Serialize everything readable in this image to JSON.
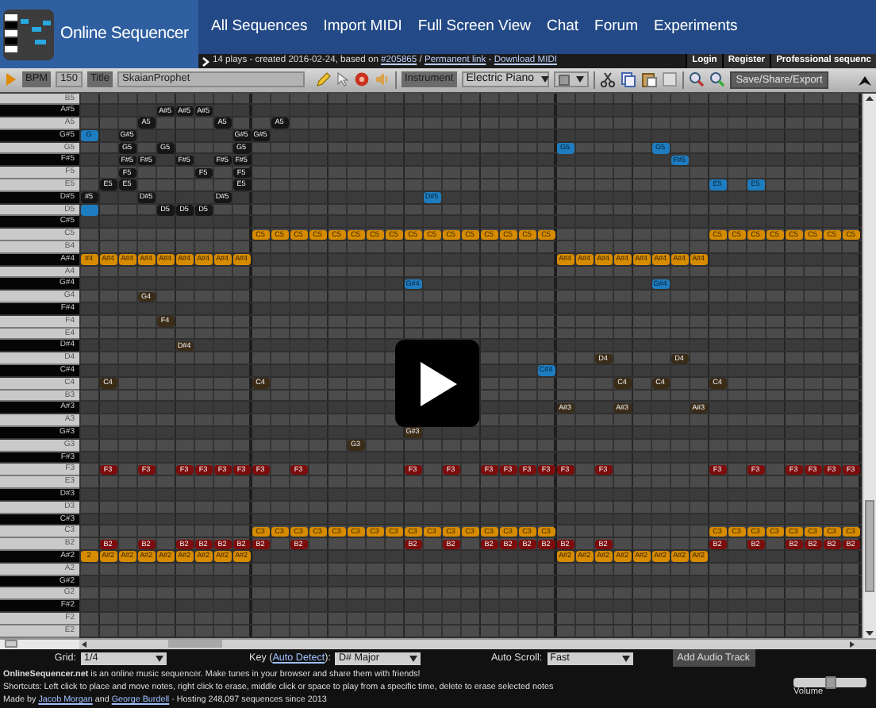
{
  "header": {
    "site_name": "Online Sequencer",
    "nav": [
      "All Sequences",
      "Import MIDI",
      "Full Screen View",
      "Chat",
      "Forum",
      "Experiments"
    ]
  },
  "info_bar": {
    "segments": [
      {
        "kind": "text",
        "text": "14 plays - created 2016-02-24, based on"
      },
      {
        "kind": "link",
        "text": "#205865"
      },
      {
        "kind": "text",
        "text": "/"
      },
      {
        "kind": "link",
        "text": "Permanent link"
      },
      {
        "kind": "text",
        "text": "-"
      },
      {
        "kind": "link",
        "text": "Download MIDI"
      }
    ],
    "account_links": [
      "Login",
      "Register",
      "Professional sequenc"
    ]
  },
  "toolbar": {
    "bpm_label": "BPM",
    "bpm": "150",
    "title_label": "Title",
    "title": "SkaianProphet",
    "instrument_label": "Instrument",
    "instrument": "Electric Piano",
    "save_button": "Save/Share/Export"
  },
  "piano_roll": {
    "rows": [
      {
        "key": "B5",
        "black": false
      },
      {
        "key": "A#5",
        "black": true,
        "cells": [
          null,
          null,
          null,
          null,
          {
            "text": "A#5",
            "color": "#161616"
          },
          {
            "text": "A#5",
            "color": "#161616"
          },
          {
            "text": "A#5",
            "color": "#161616"
          }
        ]
      },
      {
        "key": "A5",
        "black": false,
        "cells": [
          null,
          null,
          null,
          {
            "text": "A5",
            "color": "#161616"
          },
          null,
          null,
          null,
          {
            "text": "A5",
            "color": "#161616"
          },
          null,
          null,
          {
            "text": "A5",
            "color": "#161616"
          }
        ]
      },
      {
        "key": "G#5",
        "black": true,
        "cells": [
          {
            "text": "G",
            "color": "#1e7dc0"
          },
          null,
          {
            "text": "G#5",
            "color": "#161616"
          },
          null,
          null,
          null,
          null,
          null,
          {
            "text": "G#5",
            "color": "#161616"
          },
          {
            "text": "G#5",
            "color": "#161616"
          }
        ]
      },
      {
        "key": "G5",
        "black": false,
        "cells": [
          null,
          null,
          {
            "text": "G5",
            "color": "#161616"
          },
          null,
          {
            "text": "G5",
            "color": "#161616"
          },
          null,
          null,
          null,
          {
            "text": "G5",
            "color": "#161616"
          },
          null,
          null,
          null,
          null,
          null,
          null,
          null,
          null,
          null,
          null,
          null,
          null,
          null,
          null,
          null,
          null,
          {
            "text": "G5",
            "color": "#1e7dc0"
          },
          null,
          null,
          null,
          null,
          {
            "text": "G5",
            "color": "#1e7dc0"
          }
        ]
      },
      {
        "key": "F#5",
        "black": true,
        "cells": [
          null,
          null,
          {
            "text": "F#5",
            "color": "#161616"
          },
          {
            "text": "F#5",
            "color": "#161616"
          },
          null,
          {
            "text": "F#5",
            "color": "#161616"
          },
          null,
          {
            "text": "F#5",
            "color": "#161616"
          },
          {
            "text": "F#5",
            "color": "#161616"
          },
          null,
          null,
          null,
          null,
          null,
          null,
          null,
          null,
          null,
          null,
          null,
          null,
          null,
          null,
          null,
          null,
          null,
          null,
          null,
          null,
          null,
          null,
          {
            "text": "F#5",
            "color": "#1e7dc0"
          }
        ]
      },
      {
        "key": "F5",
        "black": false,
        "cells": [
          null,
          null,
          {
            "text": "F5",
            "color": "#161616"
          },
          null,
          null,
          null,
          {
            "text": "F5",
            "color": "#161616"
          },
          null,
          {
            "text": "F5",
            "color": "#161616"
          }
        ]
      },
      {
        "key": "E5",
        "black": false,
        "cells": [
          null,
          {
            "text": "E5",
            "color": "#161616"
          },
          {
            "text": "E5",
            "color": "#161616"
          },
          null,
          null,
          null,
          null,
          null,
          {
            "text": "E5",
            "color": "#161616"
          },
          null,
          null,
          null,
          null,
          null,
          null,
          null,
          null,
          null,
          null,
          null,
          null,
          null,
          null,
          null,
          null,
          null,
          null,
          null,
          null,
          null,
          null,
          null,
          null,
          {
            "text": "E5",
            "color": "#1e7dc0"
          },
          null,
          {
            "text": "E5",
            "color": "#1e7dc0"
          }
        ]
      },
      {
        "key": "D#5",
        "black": true,
        "cells": [
          {
            "text": "#5",
            "color": "#161616"
          },
          null,
          null,
          {
            "text": "D#5",
            "color": "#161616"
          },
          null,
          null,
          null,
          {
            "text": "D#5",
            "color": "#161616"
          },
          null,
          null,
          null,
          null,
          null,
          null,
          null,
          null,
          null,
          null,
          {
            "text": "D#5",
            "color": "#1e7dc0"
          }
        ]
      },
      {
        "key": "D5",
        "black": false,
        "cells": [
          {
            "color": "#1e7dc0"
          },
          null,
          null,
          null,
          {
            "text": "D5",
            "color": "#161616"
          },
          {
            "text": "D5",
            "color": "#161616"
          },
          {
            "text": "D5",
            "color": "#161616"
          }
        ]
      },
      {
        "key": "C#5",
        "black": true
      },
      {
        "key": "C5",
        "black": false,
        "cells": [
          null,
          null,
          null,
          null,
          null,
          null,
          null,
          null,
          null,
          {
            "text": "C5",
            "color": "#d68b00"
          },
          {
            "text": "C5",
            "color": "#d68b00"
          },
          {
            "text": "C5",
            "color": "#d68b00"
          },
          {
            "text": "C5",
            "color": "#d68b00"
          },
          {
            "text": "C5",
            "color": "#d68b00"
          },
          {
            "text": "C5",
            "color": "#d68b00"
          },
          {
            "text": "C5",
            "color": "#d68b00"
          },
          {
            "text": "C5",
            "color": "#d68b00"
          },
          {
            "text": "C5",
            "color": "#d68b00"
          },
          {
            "text": "C5",
            "color": "#d68b00"
          },
          {
            "text": "C5",
            "color": "#d68b00"
          },
          {
            "text": "C5",
            "color": "#d68b00"
          },
          {
            "text": "C5",
            "color": "#d68b00"
          },
          {
            "text": "C5",
            "color": "#d68b00"
          },
          {
            "text": "C5",
            "color": "#d68b00"
          },
          {
            "text": "C5",
            "color": "#d68b00"
          },
          null,
          null,
          null,
          null,
          null,
          null,
          null,
          null,
          {
            "text": "C5",
            "color": "#d68b00"
          },
          {
            "text": "C5",
            "color": "#d68b00"
          },
          {
            "text": "C5",
            "color": "#d68b00"
          },
          {
            "text": "C5",
            "color": "#d68b00"
          },
          {
            "text": "C5",
            "color": "#d68b00"
          },
          {
            "text": "C5",
            "color": "#d68b00"
          },
          {
            "text": "C5",
            "color": "#d68b00"
          },
          {
            "text": "C5",
            "color": "#d68b00"
          }
        ]
      },
      {
        "key": "B4",
        "black": false
      },
      {
        "key": "A#4",
        "black": true,
        "cells": [
          {
            "text": "#4",
            "color": "#d68b00"
          },
          {
            "text": "A#4",
            "color": "#d68b00"
          },
          {
            "text": "A#4",
            "color": "#d68b00"
          },
          {
            "text": "A#4",
            "color": "#d68b00"
          },
          {
            "text": "A#4",
            "color": "#d68b00"
          },
          {
            "text": "A#4",
            "color": "#d68b00"
          },
          {
            "text": "A#4",
            "color": "#d68b00"
          },
          {
            "text": "A#4",
            "color": "#d68b00"
          },
          {
            "text": "A#4",
            "color": "#d68b00"
          },
          null,
          null,
          null,
          null,
          null,
          null,
          null,
          null,
          null,
          null,
          null,
          null,
          null,
          null,
          null,
          null,
          {
            "text": "A#4",
            "color": "#d68b00"
          },
          {
            "text": "A#4",
            "color": "#d68b00"
          },
          {
            "text": "A#4",
            "color": "#d68b00"
          },
          {
            "text": "A#4",
            "color": "#d68b00"
          },
          {
            "text": "A#4",
            "color": "#d68b00"
          },
          {
            "text": "A#4",
            "color": "#d68b00"
          },
          {
            "text": "A#4",
            "color": "#d68b00"
          },
          {
            "text": "A#4",
            "color": "#d68b00"
          }
        ]
      },
      {
        "key": "A4",
        "black": false
      },
      {
        "key": "G#4",
        "black": true,
        "cells": [
          null,
          null,
          null,
          null,
          null,
          null,
          null,
          null,
          null,
          null,
          null,
          null,
          null,
          null,
          null,
          null,
          null,
          {
            "text": "G#4",
            "color": "#1e7dc0"
          },
          null,
          null,
          null,
          null,
          null,
          null,
          null,
          null,
          null,
          null,
          null,
          null,
          {
            "text": "G#4",
            "color": "#1e7dc0"
          }
        ]
      },
      {
        "key": "G4",
        "black": false,
        "cells": [
          null,
          null,
          null,
          {
            "text": "G4",
            "color": "#3b2c18"
          }
        ]
      },
      {
        "key": "F#4",
        "black": true
      },
      {
        "key": "F4",
        "black": false,
        "cells": [
          null,
          null,
          null,
          null,
          {
            "text": "F4",
            "color": "#3b2c18"
          }
        ]
      },
      {
        "key": "E4",
        "black": false
      },
      {
        "key": "D#4",
        "black": true,
        "cells": [
          null,
          null,
          null,
          null,
          null,
          {
            "text": "D#4",
            "color": "#3b2c18"
          }
        ]
      },
      {
        "key": "D4",
        "black": false,
        "cells": [
          null,
          null,
          null,
          null,
          null,
          null,
          null,
          null,
          null,
          null,
          null,
          null,
          null,
          null,
          null,
          null,
          null,
          null,
          null,
          null,
          null,
          null,
          null,
          null,
          null,
          null,
          null,
          {
            "text": "D4",
            "color": "#3b2c18"
          },
          null,
          null,
          null,
          {
            "text": "D4",
            "color": "#3b2c18"
          }
        ]
      },
      {
        "key": "C#4",
        "black": true,
        "cells": [
          null,
          null,
          null,
          null,
          null,
          null,
          null,
          null,
          null,
          null,
          null,
          null,
          null,
          null,
          null,
          null,
          null,
          null,
          null,
          null,
          null,
          null,
          null,
          null,
          {
            "text": "C#4",
            "color": "#1e7dc0"
          }
        ]
      },
      {
        "key": "C4",
        "black": false,
        "cells": [
          null,
          {
            "text": "C4",
            "color": "#3b2c18"
          },
          null,
          null,
          null,
          null,
          null,
          null,
          null,
          {
            "text": "C4",
            "color": "#3b2c18"
          },
          null,
          null,
          null,
          null,
          null,
          null,
          null,
          null,
          null,
          null,
          null,
          null,
          null,
          null,
          null,
          null,
          null,
          null,
          {
            "text": "C4",
            "color": "#3b2c18"
          },
          null,
          {
            "text": "C4",
            "color": "#3b2c18"
          },
          null,
          null,
          {
            "text": "C4",
            "color": "#3b2c18"
          }
        ]
      },
      {
        "key": "B3",
        "black": false
      },
      {
        "key": "A#3",
        "black": true,
        "cells": [
          null,
          null,
          null,
          null,
          null,
          null,
          null,
          null,
          null,
          null,
          null,
          null,
          null,
          null,
          null,
          null,
          null,
          null,
          null,
          null,
          null,
          null,
          null,
          null,
          null,
          {
            "text": "A#3",
            "color": "#3b2c18"
          },
          null,
          null,
          {
            "text": "A#3",
            "color": "#3b2c18"
          },
          null,
          null,
          null,
          {
            "text": "A#3",
            "color": "#3b2c18"
          }
        ]
      },
      {
        "key": "A3",
        "black": false
      },
      {
        "key": "G#3",
        "black": true,
        "cells": [
          null,
          null,
          null,
          null,
          null,
          null,
          null,
          null,
          null,
          null,
          null,
          null,
          null,
          null,
          null,
          null,
          null,
          {
            "text": "G#3",
            "color": "#3b2c18"
          }
        ]
      },
      {
        "key": "G3",
        "black": false,
        "cells": [
          null,
          null,
          null,
          null,
          null,
          null,
          null,
          null,
          null,
          null,
          null,
          null,
          null,
          null,
          {
            "text": "G3",
            "color": "#3b2c18"
          }
        ]
      },
      {
        "key": "F#3",
        "black": true
      },
      {
        "key": "F3",
        "black": false,
        "cells": [
          null,
          {
            "text": "F3",
            "color": "#7c0d0d"
          },
          null,
          {
            "text": "F3",
            "color": "#7c0d0d"
          },
          null,
          {
            "text": "F3",
            "color": "#7c0d0d"
          },
          {
            "text": "F3",
            "color": "#7c0d0d"
          },
          {
            "text": "F3",
            "color": "#7c0d0d"
          },
          {
            "text": "F3",
            "color": "#7c0d0d"
          },
          {
            "text": "F3",
            "color": "#7c0d0d"
          },
          null,
          {
            "text": "F3",
            "color": "#7c0d0d"
          },
          null,
          null,
          null,
          null,
          null,
          {
            "text": "F3",
            "color": "#7c0d0d"
          },
          null,
          {
            "text": "F3",
            "color": "#7c0d0d"
          },
          null,
          {
            "text": "F3",
            "color": "#7c0d0d"
          },
          {
            "text": "F3",
            "color": "#7c0d0d"
          },
          {
            "text": "F3",
            "color": "#7c0d0d"
          },
          {
            "text": "F3",
            "color": "#7c0d0d"
          },
          {
            "text": "F3",
            "color": "#7c0d0d"
          },
          null,
          {
            "text": "F3",
            "color": "#7c0d0d"
          },
          null,
          null,
          null,
          null,
          null,
          {
            "text": "F3",
            "color": "#7c0d0d"
          },
          null,
          {
            "text": "F3",
            "color": "#7c0d0d"
          },
          null,
          {
            "text": "F3",
            "color": "#7c0d0d"
          },
          {
            "text": "F3",
            "color": "#7c0d0d"
          },
          {
            "text": "F3",
            "color": "#7c0d0d"
          },
          {
            "text": "F3",
            "color": "#7c0d0d"
          }
        ]
      },
      {
        "key": "E3",
        "black": false
      },
      {
        "key": "D#3",
        "black": true
      },
      {
        "key": "D3",
        "black": false
      },
      {
        "key": "C#3",
        "black": true
      },
      {
        "key": "C3",
        "black": false,
        "cells": [
          null,
          null,
          null,
          null,
          null,
          null,
          null,
          null,
          null,
          {
            "text": "C3",
            "color": "#d68b00"
          },
          {
            "text": "C3",
            "color": "#d68b00"
          },
          {
            "text": "C3",
            "color": "#d68b00"
          },
          {
            "text": "C3",
            "color": "#d68b00"
          },
          {
            "text": "C3",
            "color": "#d68b00"
          },
          {
            "text": "C3",
            "color": "#d68b00"
          },
          {
            "text": "C3",
            "color": "#d68b00"
          },
          {
            "text": "C3",
            "color": "#d68b00"
          },
          {
            "text": "C3",
            "color": "#d68b00"
          },
          {
            "text": "C3",
            "color": "#d68b00"
          },
          {
            "text": "C3",
            "color": "#d68b00"
          },
          {
            "text": "C3",
            "color": "#d68b00"
          },
          {
            "text": "C3",
            "color": "#d68b00"
          },
          {
            "text": "C3",
            "color": "#d68b00"
          },
          {
            "text": "C3",
            "color": "#d68b00"
          },
          {
            "text": "C3",
            "color": "#d68b00"
          },
          null,
          null,
          null,
          null,
          null,
          null,
          null,
          null,
          {
            "text": "C3",
            "color": "#d68b00"
          },
          {
            "text": "C3",
            "color": "#d68b00"
          },
          {
            "text": "C3",
            "color": "#d68b00"
          },
          {
            "text": "C3",
            "color": "#d68b00"
          },
          {
            "text": "C3",
            "color": "#d68b00"
          },
          {
            "text": "C3",
            "color": "#d68b00"
          },
          {
            "text": "C3",
            "color": "#d68b00"
          },
          {
            "text": "C3",
            "color": "#d68b00"
          }
        ]
      },
      {
        "key": "B2",
        "black": false,
        "cells": [
          null,
          {
            "text": "B2",
            "color": "#7c0d0d"
          },
          null,
          {
            "text": "B2",
            "color": "#7c0d0d"
          },
          null,
          {
            "text": "B2",
            "color": "#7c0d0d"
          },
          {
            "text": "B2",
            "color": "#7c0d0d"
          },
          {
            "text": "B2",
            "color": "#7c0d0d"
          },
          {
            "text": "B2",
            "color": "#7c0d0d"
          },
          {
            "text": "B2",
            "color": "#7c0d0d"
          },
          null,
          {
            "text": "B2",
            "color": "#7c0d0d"
          },
          null,
          null,
          null,
          null,
          null,
          {
            "text": "B2",
            "color": "#7c0d0d"
          },
          null,
          {
            "text": "B2",
            "color": "#7c0d0d"
          },
          null,
          {
            "text": "B2",
            "color": "#7c0d0d"
          },
          {
            "text": "B2",
            "color": "#7c0d0d"
          },
          {
            "text": "B2",
            "color": "#7c0d0d"
          },
          {
            "text": "B2",
            "color": "#7c0d0d"
          },
          {
            "text": "B2",
            "color": "#7c0d0d"
          },
          null,
          {
            "text": "B2",
            "color": "#7c0d0d"
          },
          null,
          null,
          null,
          null,
          null,
          {
            "text": "B2",
            "color": "#7c0d0d"
          },
          null,
          {
            "text": "B2",
            "color": "#7c0d0d"
          },
          null,
          {
            "text": "B2",
            "color": "#7c0d0d"
          },
          {
            "text": "B2",
            "color": "#7c0d0d"
          },
          {
            "text": "B2",
            "color": "#7c0d0d"
          },
          {
            "text": "B2",
            "color": "#7c0d0d"
          }
        ]
      },
      {
        "key": "A#2",
        "black": true,
        "cells": [
          {
            "text": "2",
            "color": "#d68b00"
          },
          {
            "text": "A#2",
            "color": "#d68b00"
          },
          {
            "text": "A#2",
            "color": "#d68b00"
          },
          {
            "text": "A#2",
            "color": "#d68b00"
          },
          {
            "text": "A#2",
            "color": "#d68b00"
          },
          {
            "text": "A#2",
            "color": "#d68b00"
          },
          {
            "text": "A#2",
            "color": "#d68b00"
          },
          {
            "text": "A#2",
            "color": "#d68b00"
          },
          {
            "text": "A#2",
            "color": "#d68b00"
          },
          null,
          null,
          null,
          null,
          null,
          null,
          null,
          null,
          null,
          null,
          null,
          null,
          null,
          null,
          null,
          null,
          {
            "text": "A#2",
            "color": "#d68b00"
          },
          {
            "text": "A#2",
            "color": "#d68b00"
          },
          {
            "text": "A#2",
            "color": "#d68b00"
          },
          {
            "text": "A#2",
            "color": "#d68b00"
          },
          {
            "text": "A#2",
            "color": "#d68b00"
          },
          {
            "text": "A#2",
            "color": "#d68b00"
          },
          {
            "text": "A#2",
            "color": "#d68b00"
          },
          {
            "text": "A#2",
            "color": "#d68b00"
          }
        ]
      },
      {
        "key": "A2",
        "black": false
      },
      {
        "key": "G#2",
        "black": true
      },
      {
        "key": "G2",
        "black": false
      },
      {
        "key": "F#2",
        "black": true
      },
      {
        "key": "F2",
        "black": false
      },
      {
        "key": "E2",
        "black": false
      }
    ]
  },
  "settings": {
    "grid_label": "Grid:",
    "grid": "1/4",
    "key_label": [
      {
        "kind": "text",
        "text": "Key ("
      },
      {
        "kind": "link",
        "text": "Auto Detect"
      },
      {
        "kind": "text",
        "text": "):"
      }
    ],
    "key": "D# Major",
    "autoscroll_label": "Auto Scroll:",
    "autoscroll": "Fast",
    "add_audio_button": "Add Audio Track"
  },
  "about": {
    "intro": "**OnlineSequencer.net** is an online music sequencer. Make tunes in your browser and share them with friends!",
    "shortcuts": "Shortcuts: Left click to place and move notes, right click to erase, middle click or space to play from a specific time, delete to erase selected notes",
    "made_by": [
      {
        "kind": "text",
        "text": "Made by"
      },
      {
        "kind": "link",
        "text": "Jacob Morgan"
      },
      {
        "kind": "text",
        "text": "and"
      },
      {
        "kind": "link",
        "text": "George Burdell"
      },
      {
        "kind": "text",
        "text": "· Hosting 248,097 sequences since 2013"
      }
    ]
  },
  "volume": {
    "label": "Volume",
    "level": 0.5
  }
}
